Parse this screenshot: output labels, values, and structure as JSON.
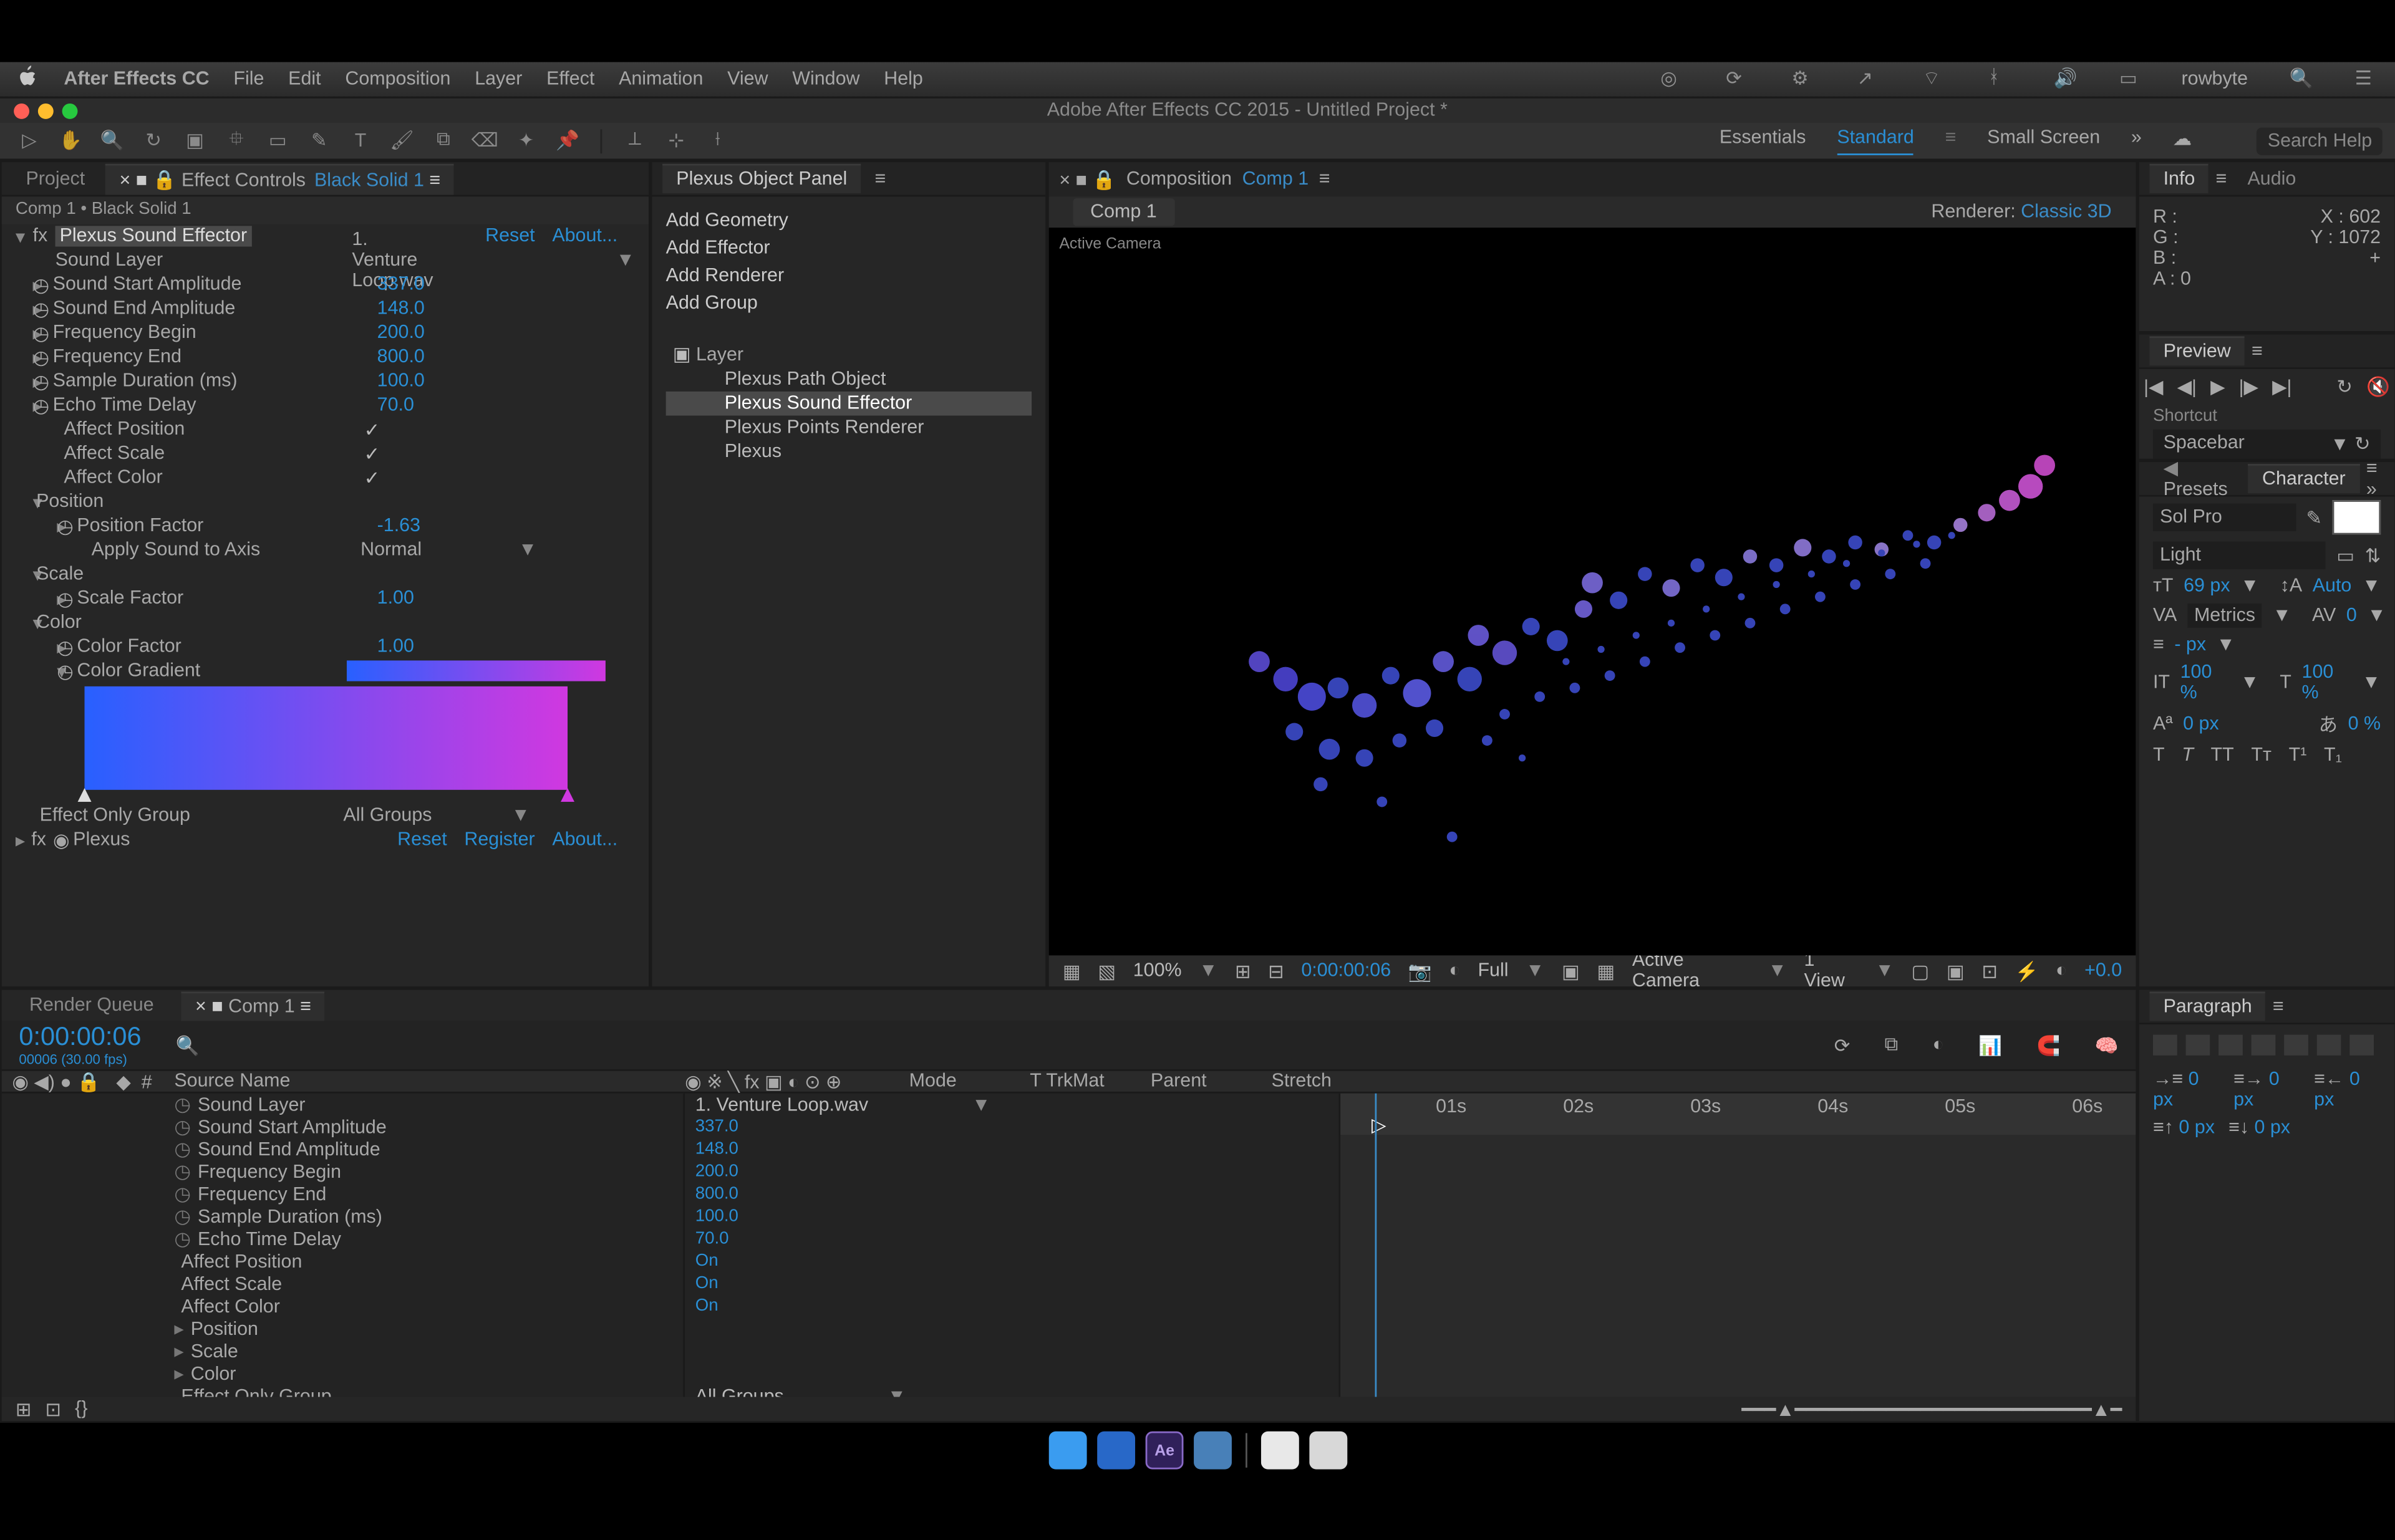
{
  "app": {
    "name": "After Effects CC",
    "title": "Adobe After Effects CC 2015 - Untitled Project *"
  },
  "menubar": [
    "File",
    "Edit",
    "Composition",
    "Layer",
    "Effect",
    "Animation",
    "View",
    "Window",
    "Help"
  ],
  "status_user": "rowbyte",
  "workspaces": {
    "items": [
      "Essentials",
      "Standard",
      "Small Screen"
    ],
    "active": "Standard",
    "search": "Search Help"
  },
  "left": {
    "tabs": {
      "project": "Project",
      "ec_prefix": "Effect Controls",
      "ec_target": "Black Solid 1"
    },
    "crumb": "Comp 1 • Black Solid 1",
    "fx1": {
      "name": "Plexus Sound Effector",
      "reset": "Reset",
      "about": "About..."
    },
    "props": {
      "sound_layer_label": "Sound Layer",
      "sound_layer_val": "1. Venture Loop.wav",
      "ssa_label": "Sound Start Amplitude",
      "ssa_val": "337.0",
      "sea_label": "Sound End Amplitude",
      "sea_val": "148.0",
      "fb_label": "Frequency Begin",
      "fb_val": "200.0",
      "fe_label": "Frequency End",
      "fe_val": "800.0",
      "sd_label": "Sample Duration (ms)",
      "sd_val": "100.0",
      "etd_label": "Echo Time Delay",
      "etd_val": "70.0",
      "ap_label": "Affect Position",
      "as_label": "Affect Scale",
      "ac_label": "Affect Color",
      "pos_label": "Position",
      "pf_label": "Position Factor",
      "pf_val": "-1.63",
      "asa_label": "Apply Sound to Axis",
      "asa_val": "Normal",
      "scale_label": "Scale",
      "sf_label": "Scale Factor",
      "sf_val": "1.00",
      "color_label": "Color",
      "cf_label": "Color Factor",
      "cf_val": "1.00",
      "cg_label": "Color Gradient",
      "eog_label": "Effect Only Group",
      "eog_val": "All Groups"
    },
    "fx2": {
      "name": "Plexus",
      "reset": "Reset",
      "register": "Register",
      "about": "About..."
    }
  },
  "plexus": {
    "title": "Plexus Object Panel",
    "actions": [
      "Add Geometry",
      "Add Effector",
      "Add Renderer",
      "Add Group"
    ],
    "layer_label": "Layer",
    "nodes": [
      "Plexus Path Object",
      "Plexus Sound Effector",
      "Plexus Points Renderer",
      "Plexus"
    ],
    "selected": "Plexus Sound Effector"
  },
  "comp": {
    "tab_prefix": "Composition",
    "tab_name": "Comp 1",
    "chip": "Comp 1",
    "renderer_label": "Renderer:",
    "renderer_val": "Classic 3D",
    "active_cam": "Active Camera",
    "footer": {
      "zoom": "100%",
      "time": "0:00:00:06",
      "res": "Full",
      "cam": "Active Camera",
      "view": "1 View",
      "exp": "+0.0"
    }
  },
  "info": {
    "tabs": [
      "Info",
      "Audio"
    ],
    "R": "R :",
    "G": "G :",
    "B": "B :",
    "A": "A : 0",
    "X": "X : 602",
    "Y": "Y : 1072"
  },
  "preview": {
    "title": "Preview",
    "shortcut_label": "Shortcut",
    "shortcut_val": "Spacebar"
  },
  "character": {
    "tabs": [
      "Presets",
      "Character"
    ],
    "font": "Sol Pro",
    "weight": "Light",
    "size": "69 px",
    "leading": "Auto",
    "kerning": "Metrics",
    "tracking": "0",
    "vscale": "- px",
    "h100a": "100 %",
    "h100b": "100 %",
    "px0a": "0 px",
    "pc0": "0 %"
  },
  "timeline": {
    "tabs": {
      "rq": "Render Queue",
      "comp": "Comp 1"
    },
    "timecode": "0:00:00:06",
    "timecode_sub": "00006 (30.00 fps)",
    "cols": {
      "source": "Source Name",
      "mode": "Mode",
      "trkmat": "T  TrkMat",
      "parent": "Parent",
      "stretch": "Stretch"
    },
    "rows": [
      {
        "label": "Sound Layer",
        "val": "1. Venture Loop.wav"
      },
      {
        "label": "Sound Start Amplitude",
        "val": "337.0"
      },
      {
        "label": "Sound End Amplitude",
        "val": "148.0"
      },
      {
        "label": "Frequency Begin",
        "val": "200.0"
      },
      {
        "label": "Frequency End",
        "val": "800.0"
      },
      {
        "label": "Sample Duration (ms)",
        "val": "100.0"
      },
      {
        "label": "Echo Time Delay",
        "val": "70.0"
      },
      {
        "label": "Affect Position",
        "val": "On"
      },
      {
        "label": "Affect Scale",
        "val": "On"
      },
      {
        "label": "Affect Color",
        "val": "On"
      },
      {
        "label": "Position",
        "val": ""
      },
      {
        "label": "Scale",
        "val": ""
      },
      {
        "label": "Color",
        "val": ""
      },
      {
        "label": "Effect Only Group",
        "val": "All Groups"
      }
    ],
    "ruler": [
      "01s",
      "02s",
      "03s",
      "04s",
      "05s",
      "06s"
    ]
  },
  "paragraph": {
    "title": "Paragraph",
    "px": "0 px"
  }
}
